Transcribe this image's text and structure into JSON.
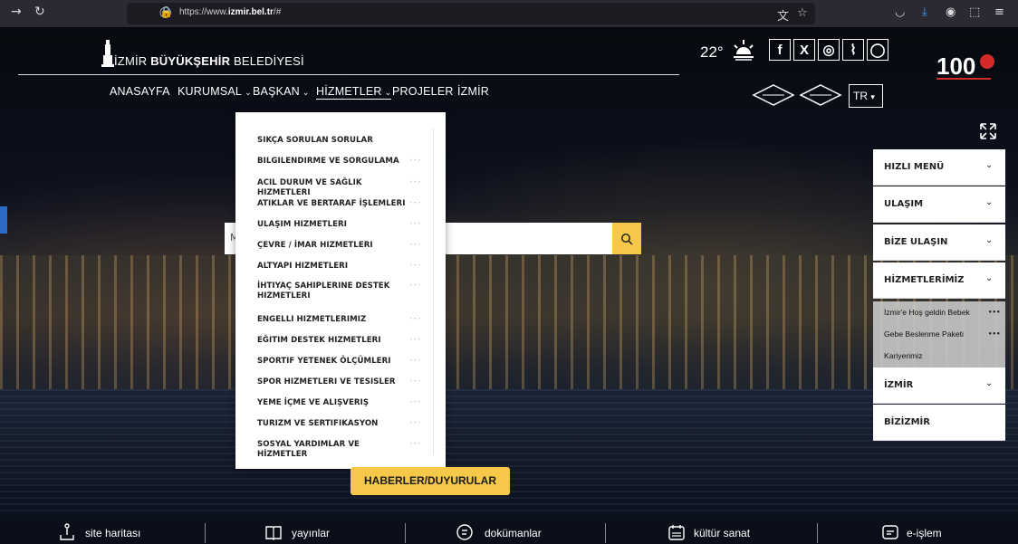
{
  "browser": {
    "url_prefix": "https://www.",
    "url_domain": "izmir.bel.tr",
    "url_suffix": "/#"
  },
  "header": {
    "logo_part1": "İZMİR ",
    "logo_part2": "BÜYÜKŞEHİR",
    "logo_part3": " BELEDİYESİ",
    "temperature": "22°",
    "weather_icon": "sun-icon",
    "social": [
      "f",
      "X",
      "◎",
      "⌇",
      "◯"
    ],
    "language": "TR",
    "badge_text": "100"
  },
  "nav": {
    "items": [
      {
        "label": "ANASAYFA",
        "caret": ""
      },
      {
        "label": "KURUMSAL",
        "caret": "⌄"
      },
      {
        "label": "BAŞKAN",
        "caret": "⌄"
      },
      {
        "label": "HİZMETLER",
        "caret": "⌄"
      },
      {
        "label": "PROJELER",
        "caret": ""
      },
      {
        "label": "İZMİR",
        "caret": ""
      }
    ]
  },
  "dropdown": {
    "items": [
      {
        "label": "SIKÇA SORULAN SORULAR",
        "dots": ""
      },
      {
        "label": "BILGILENDIRME VE SORGULAMA",
        "dots": "•••"
      },
      {
        "label": "ACIL DURUM VE SAĞLIK HIZMETLERI",
        "dots": "•••"
      },
      {
        "label": "ATIKLAR VE BERTARAF İŞLEMLERI",
        "dots": "•••"
      },
      {
        "label": "ULAŞIM HIZMETLERI",
        "dots": "•••"
      },
      {
        "label": "ÇEVRE / İMAR HIZMETLERI",
        "dots": "•••"
      },
      {
        "label": "ALTYAPI HIZMETLERI",
        "dots": "•••"
      },
      {
        "label": "İHTIYAÇ SAHIPLERINE DESTEK HIZMETLERI",
        "dots": "•••"
      },
      {
        "label": "ENGELLI HIZMETLERIMIZ",
        "dots": "•••"
      },
      {
        "label": "EĞITIM DESTEK HIZMETLERI",
        "dots": "•••"
      },
      {
        "label": "SPORTIF YETENEK ÖLÇÜMLERI",
        "dots": "•••"
      },
      {
        "label": "SPOR HIZMETLERI VE TESISLER",
        "dots": "•••"
      },
      {
        "label": "YEME İÇME VE ALIŞVERIŞ",
        "dots": "•••"
      },
      {
        "label": "TURIZM VE SERTIFIKASYON",
        "dots": "•••"
      },
      {
        "label": "SOSYAL YARDIMLAR VE HİZMETLER",
        "dots": "•••"
      }
    ]
  },
  "accordion": {
    "items": [
      {
        "label": "HIZLI MENÜ",
        "caret": "⌄"
      },
      {
        "label": "ULAŞIM",
        "caret": "⌄"
      },
      {
        "label": "BİZE ULAŞIN",
        "caret": "⌄"
      },
      {
        "label": "HİZMETLERİMİZ",
        "caret": "⌄"
      },
      {
        "label": "İZMİR",
        "caret": "⌄"
      },
      {
        "label": "BİZİZMİR",
        "caret": ""
      }
    ],
    "sub_items": [
      {
        "label": "İzmir'e Hoş geldin Bebek",
        "dots": "•••"
      },
      {
        "label": "Gebe Beslenme Paketi",
        "dots": "•••"
      },
      {
        "label": "Kariyerimiz",
        "dots": ""
      }
    ]
  },
  "search": {
    "left_letter": "M"
  },
  "news_button": "HABERLER/DUYURULAR",
  "footer": {
    "items": [
      {
        "label": "site haritası",
        "icon": "sitemap-icon"
      },
      {
        "label": "yayınlar",
        "icon": "book-icon"
      },
      {
        "label": "dokümanlar",
        "icon": "document-icon"
      },
      {
        "label": "kültür sanat",
        "icon": "calendar-icon"
      },
      {
        "label": "e-işlem",
        "icon": "chat-icon"
      }
    ]
  }
}
